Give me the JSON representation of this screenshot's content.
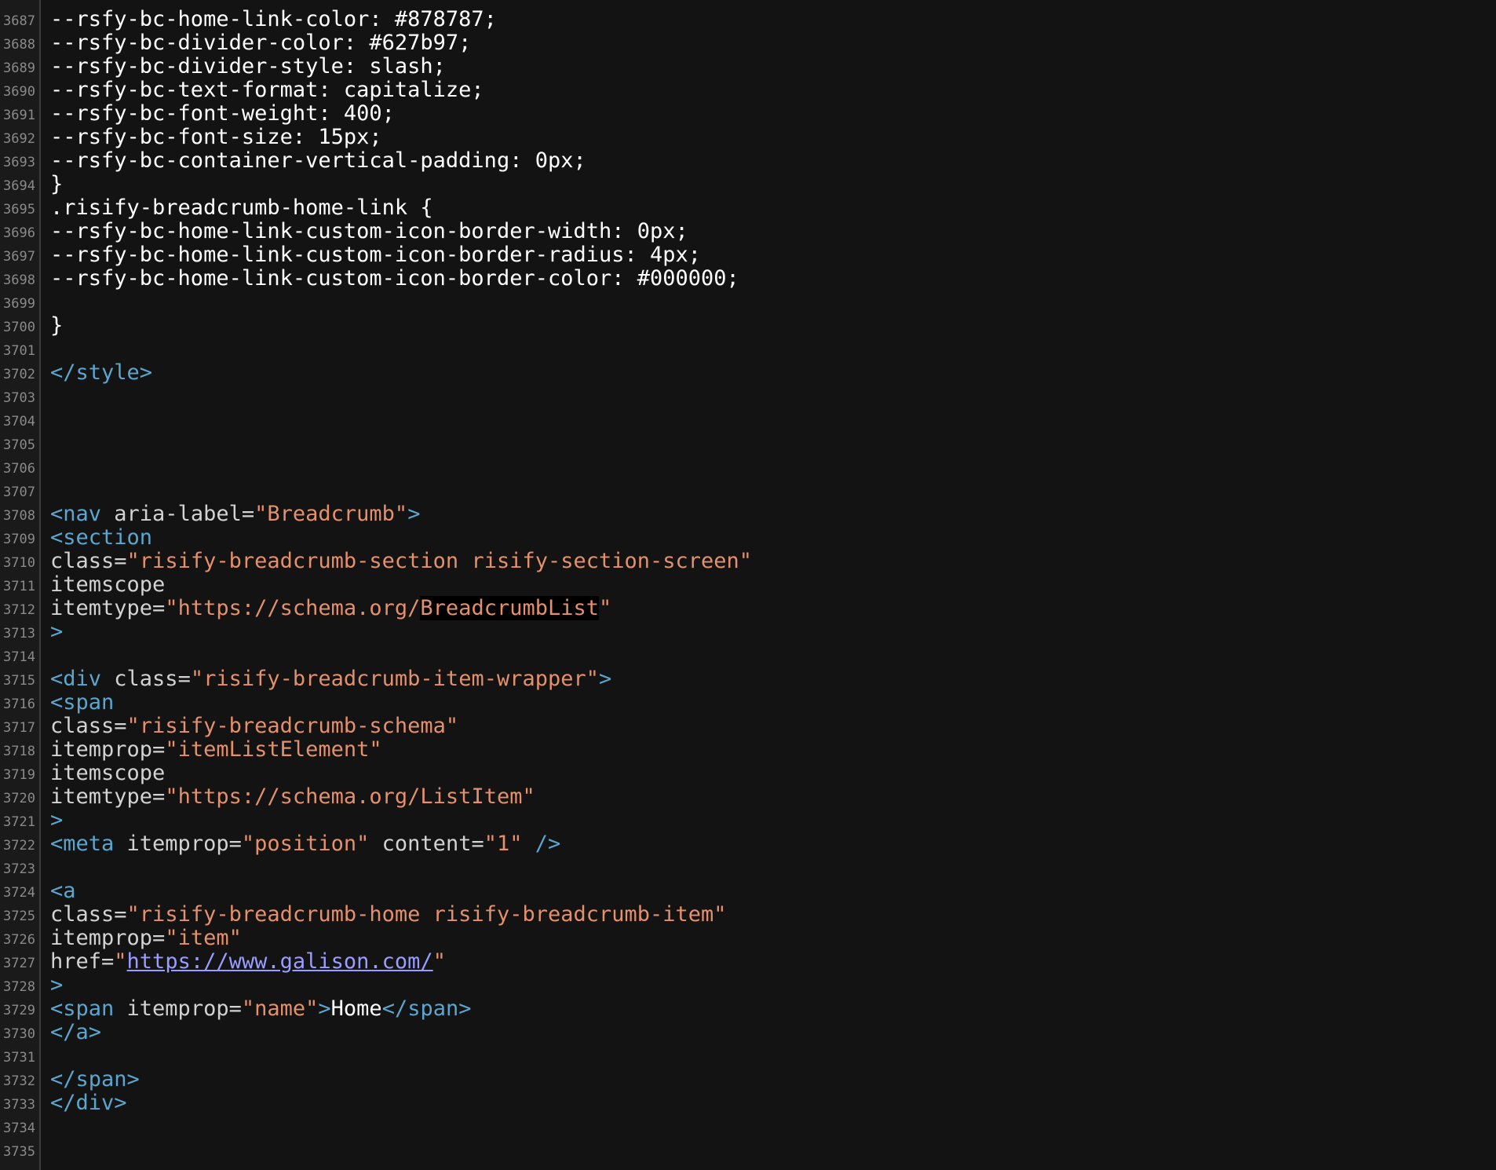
{
  "lines": [
    {
      "n": "3687",
      "segs": [
        {
          "t": "--rsfy-bc-home-link-color: #878787;",
          "c": "text"
        }
      ]
    },
    {
      "n": "3688",
      "segs": [
        {
          "t": "--rsfy-bc-divider-color: #627b97;",
          "c": "text"
        }
      ]
    },
    {
      "n": "3689",
      "segs": [
        {
          "t": "--rsfy-bc-divider-style: slash;",
          "c": "text"
        }
      ]
    },
    {
      "n": "3690",
      "segs": [
        {
          "t": "--rsfy-bc-text-format: capitalize;",
          "c": "text"
        }
      ]
    },
    {
      "n": "3691",
      "segs": [
        {
          "t": "--rsfy-bc-font-weight: 400;",
          "c": "text"
        }
      ]
    },
    {
      "n": "3692",
      "segs": [
        {
          "t": "--rsfy-bc-font-size: 15px;",
          "c": "text"
        }
      ]
    },
    {
      "n": "3693",
      "segs": [
        {
          "t": "--rsfy-bc-container-vertical-padding: 0px;",
          "c": "text"
        }
      ]
    },
    {
      "n": "3694",
      "segs": [
        {
          "t": "}",
          "c": "text"
        }
      ]
    },
    {
      "n": "3695",
      "segs": [
        {
          "t": ".risify-breadcrumb-home-link {",
          "c": "text"
        }
      ]
    },
    {
      "n": "3696",
      "segs": [
        {
          "t": "--rsfy-bc-home-link-custom-icon-border-width: 0px;",
          "c": "text"
        }
      ]
    },
    {
      "n": "3697",
      "segs": [
        {
          "t": "--rsfy-bc-home-link-custom-icon-border-radius: 4px;",
          "c": "text"
        }
      ]
    },
    {
      "n": "3698",
      "segs": [
        {
          "t": "--rsfy-bc-home-link-custom-icon-border-color: #000000;",
          "c": "text"
        }
      ]
    },
    {
      "n": "3699",
      "segs": []
    },
    {
      "n": "3700",
      "segs": [
        {
          "t": "}",
          "c": "text"
        }
      ]
    },
    {
      "n": "3701",
      "segs": []
    },
    {
      "n": "3702",
      "segs": [
        {
          "t": "</style>",
          "c": "tag"
        }
      ]
    },
    {
      "n": "3703",
      "segs": []
    },
    {
      "n": "3704",
      "segs": []
    },
    {
      "n": "3705",
      "segs": []
    },
    {
      "n": "3706",
      "segs": []
    },
    {
      "n": "3707",
      "segs": []
    },
    {
      "n": "3708",
      "segs": [
        {
          "t": "<nav",
          "c": "tag"
        },
        {
          "t": " aria-label=",
          "c": "attr"
        },
        {
          "t": "\"Breadcrumb\"",
          "c": "val"
        },
        {
          "t": ">",
          "c": "tag"
        }
      ]
    },
    {
      "n": "3709",
      "segs": [
        {
          "t": "<section",
          "c": "tag"
        }
      ]
    },
    {
      "n": "3710",
      "segs": [
        {
          "t": "class=",
          "c": "attr"
        },
        {
          "t": "\"risify-breadcrumb-section risify-section-screen\"",
          "c": "val"
        }
      ]
    },
    {
      "n": "3711",
      "segs": [
        {
          "t": "itemscope",
          "c": "attr"
        }
      ]
    },
    {
      "n": "3712",
      "segs": [
        {
          "t": "itemtype=",
          "c": "attr"
        },
        {
          "t": "\"https://schema.org/",
          "c": "val"
        },
        {
          "t": "BreadcrumbList",
          "c": "val-hl"
        },
        {
          "t": "\"",
          "c": "val"
        }
      ]
    },
    {
      "n": "3713",
      "segs": [
        {
          "t": ">",
          "c": "tag"
        }
      ]
    },
    {
      "n": "3714",
      "segs": []
    },
    {
      "n": "3715",
      "segs": [
        {
          "t": "<div",
          "c": "tag"
        },
        {
          "t": " class=",
          "c": "attr"
        },
        {
          "t": "\"risify-breadcrumb-item-wrapper\"",
          "c": "val"
        },
        {
          "t": ">",
          "c": "tag"
        }
      ]
    },
    {
      "n": "3716",
      "segs": [
        {
          "t": "<span",
          "c": "tag"
        }
      ]
    },
    {
      "n": "3717",
      "segs": [
        {
          "t": "class=",
          "c": "attr"
        },
        {
          "t": "\"risify-breadcrumb-schema\"",
          "c": "val"
        }
      ]
    },
    {
      "n": "3718",
      "segs": [
        {
          "t": "itemprop=",
          "c": "attr"
        },
        {
          "t": "\"itemListElement\"",
          "c": "val"
        }
      ]
    },
    {
      "n": "3719",
      "segs": [
        {
          "t": "itemscope",
          "c": "attr"
        }
      ]
    },
    {
      "n": "3720",
      "segs": [
        {
          "t": "itemtype=",
          "c": "attr"
        },
        {
          "t": "\"https://schema.org/ListItem\"",
          "c": "val"
        }
      ]
    },
    {
      "n": "3721",
      "segs": [
        {
          "t": ">",
          "c": "tag"
        }
      ]
    },
    {
      "n": "3722",
      "segs": [
        {
          "t": "<meta",
          "c": "tag"
        },
        {
          "t": " itemprop=",
          "c": "attr"
        },
        {
          "t": "\"position\"",
          "c": "val"
        },
        {
          "t": " content=",
          "c": "attr"
        },
        {
          "t": "\"1\"",
          "c": "val"
        },
        {
          "t": " />",
          "c": "tag"
        }
      ]
    },
    {
      "n": "3723",
      "segs": []
    },
    {
      "n": "3724",
      "segs": [
        {
          "t": "<a",
          "c": "tag"
        }
      ]
    },
    {
      "n": "3725",
      "segs": [
        {
          "t": "class=",
          "c": "attr"
        },
        {
          "t": "\"risify-breadcrumb-home risify-breadcrumb-item\"",
          "c": "val"
        }
      ]
    },
    {
      "n": "3726",
      "segs": [
        {
          "t": "itemprop=",
          "c": "attr"
        },
        {
          "t": "\"item\"",
          "c": "val"
        }
      ]
    },
    {
      "n": "3727",
      "segs": [
        {
          "t": "href=",
          "c": "attr"
        },
        {
          "t": "\"",
          "c": "val"
        },
        {
          "t": "https://www.galison.com/",
          "c": "link"
        },
        {
          "t": "\"",
          "c": "val"
        }
      ]
    },
    {
      "n": "3728",
      "segs": [
        {
          "t": ">",
          "c": "tag"
        }
      ]
    },
    {
      "n": "3729",
      "segs": [
        {
          "t": "<span",
          "c": "tag"
        },
        {
          "t": " itemprop=",
          "c": "attr"
        },
        {
          "t": "\"name\"",
          "c": "val"
        },
        {
          "t": ">",
          "c": "tag"
        },
        {
          "t": "Home",
          "c": "text"
        },
        {
          "t": "</span>",
          "c": "tag"
        }
      ]
    },
    {
      "n": "3730",
      "segs": [
        {
          "t": "</a>",
          "c": "tag"
        }
      ]
    },
    {
      "n": "3731",
      "segs": []
    },
    {
      "n": "3732",
      "segs": [
        {
          "t": "</span>",
          "c": "tag"
        }
      ]
    },
    {
      "n": "3733",
      "segs": [
        {
          "t": "</div>",
          "c": "tag"
        }
      ]
    },
    {
      "n": "3734",
      "segs": []
    },
    {
      "n": "3735",
      "segs": []
    }
  ],
  "colors": {
    "background": "#131313",
    "gutter": "#1a1a1a",
    "line_number": "#8a8a8a",
    "tag": "#5aa6cf",
    "attribute": "#d2d2d2",
    "value": "#e4906b",
    "text": "#ffffff",
    "link": "#9a9cff"
  }
}
